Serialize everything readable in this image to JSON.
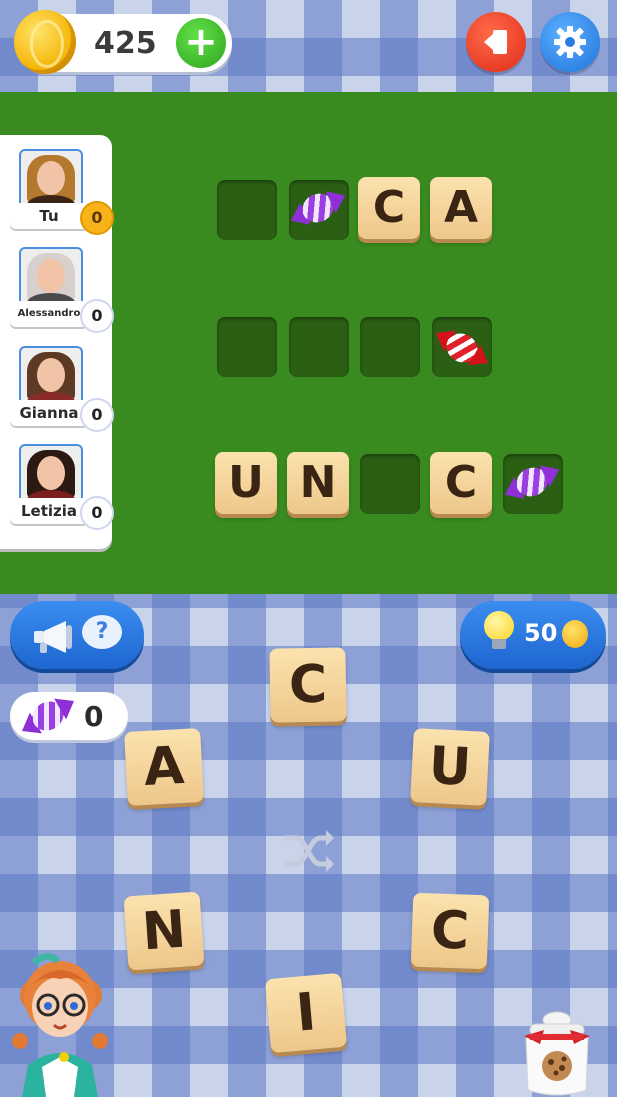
{
  "hud": {
    "coins": "425",
    "add_coins_icon": "plus-icon",
    "exit_icon": "exit-icon",
    "settings_icon": "gear-icon"
  },
  "players": [
    {
      "name": "Tu",
      "score": "0"
    },
    {
      "name": "Alessandro",
      "score": "0"
    },
    {
      "name": "Gianna",
      "score": "0"
    },
    {
      "name": "Letizia",
      "score": "0"
    }
  ],
  "board": {
    "words": [
      {
        "cells": [
          "",
          "candy-purple",
          "C",
          "A"
        ]
      },
      {
        "cells": [
          "",
          "",
          "",
          "candy-red"
        ]
      },
      {
        "cells": [
          "U",
          "N",
          "",
          "C",
          "candy-purple"
        ]
      }
    ]
  },
  "controls": {
    "hint_icons": [
      "megaphone-icon",
      "question-bubble-icon"
    ],
    "bubble_text": "?",
    "bulb_cost": "50",
    "candy_count": "0",
    "shuffle_icon": "shuffle-icon"
  },
  "letter_wheel": [
    "C",
    "A",
    "U",
    "N",
    "C",
    "I"
  ],
  "colors": {
    "board": "#3a8b1f",
    "slot": "#2a5f14",
    "tile": "#eec78a",
    "accent_blue": "#1e66d0"
  }
}
